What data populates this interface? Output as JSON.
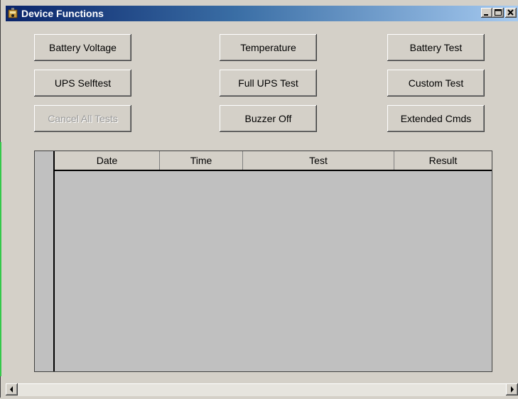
{
  "window": {
    "title": "Device Functions"
  },
  "buttons": {
    "battery_voltage": "Battery Voltage",
    "temperature": "Temperature",
    "battery_test": "Battery Test",
    "ups_selftest": "UPS Selftest",
    "full_ups_test": "Full UPS Test",
    "custom_test": "Custom Test",
    "cancel_all_tests": "Cancel All Tests",
    "buzzer_off": "Buzzer Off",
    "extended_cmds": "Extended Cmds"
  },
  "table": {
    "columns": [
      "Date",
      "Time",
      "Test",
      "Result"
    ],
    "rows": []
  },
  "icons": {
    "app": "ups-app-icon",
    "minimize": "minimize-icon",
    "maximize": "maximize-icon",
    "close": "close-icon",
    "scroll_left": "arrow-left-icon",
    "scroll_right": "arrow-right-icon"
  },
  "colors": {
    "titlebar_start": "#0a246a",
    "titlebar_end": "#a6caf0",
    "face": "#d4d0c8",
    "grid_bg": "#c0c0c0",
    "disabled_text": "#9a9a9a"
  }
}
